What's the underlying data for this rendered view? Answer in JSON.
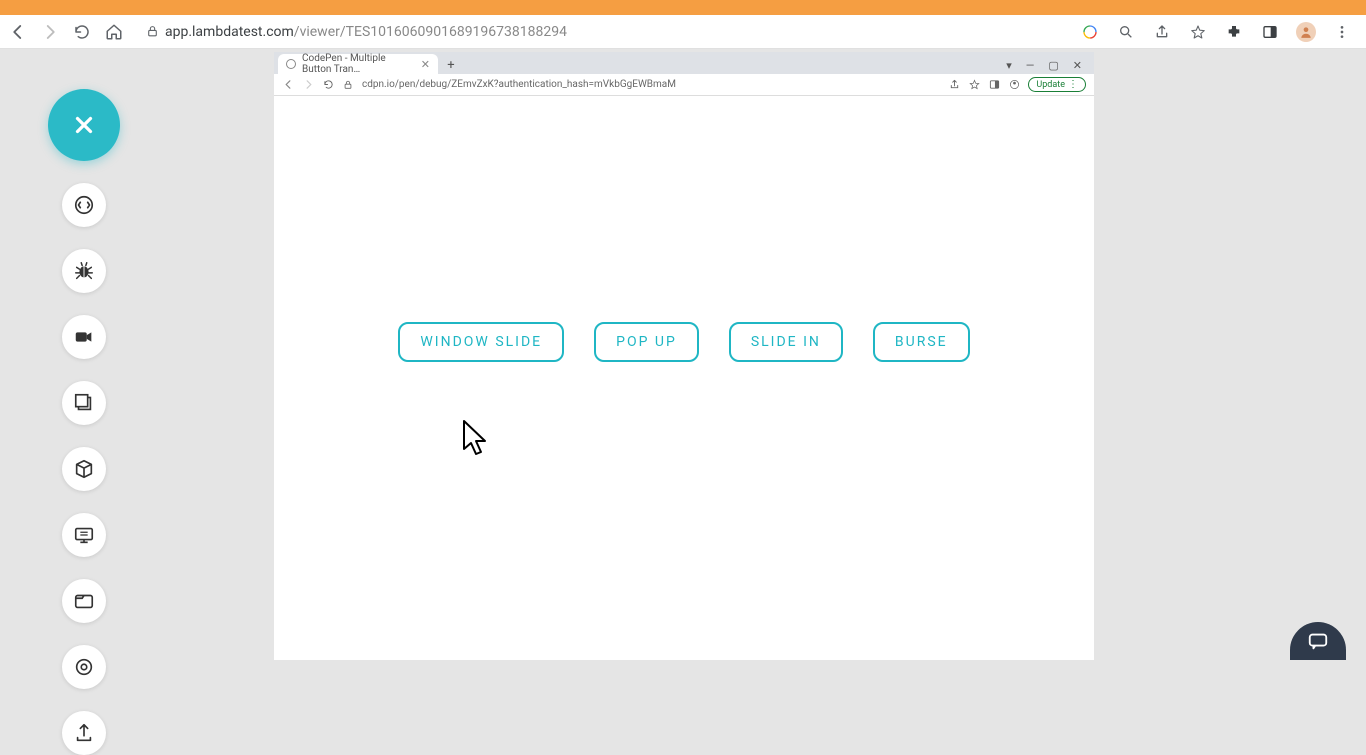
{
  "outer_browser": {
    "url_display": "app.lambdatest.com/viewer/TES10160609016891967381882­94",
    "url_host": "app.lambdatest.com",
    "url_path": "/viewer/TES10160609016891967381882­94"
  },
  "sidebar": {},
  "embedded": {
    "tab_title": "CodePen - Multiple Button Tran…",
    "url": "cdpn.io/pen/debug/ZEmvZxK?authentication_hash=mVkbGgEWBmaM",
    "update_label": "Update",
    "buttons": [
      {
        "label": "WINDOW SLIDE"
      },
      {
        "label": "POP UP"
      },
      {
        "label": "SLIDE IN"
      },
      {
        "label": "BURSE"
      }
    ]
  },
  "colors": {
    "accent": "#2bbac7",
    "btn_border": "#1fb6c4"
  }
}
